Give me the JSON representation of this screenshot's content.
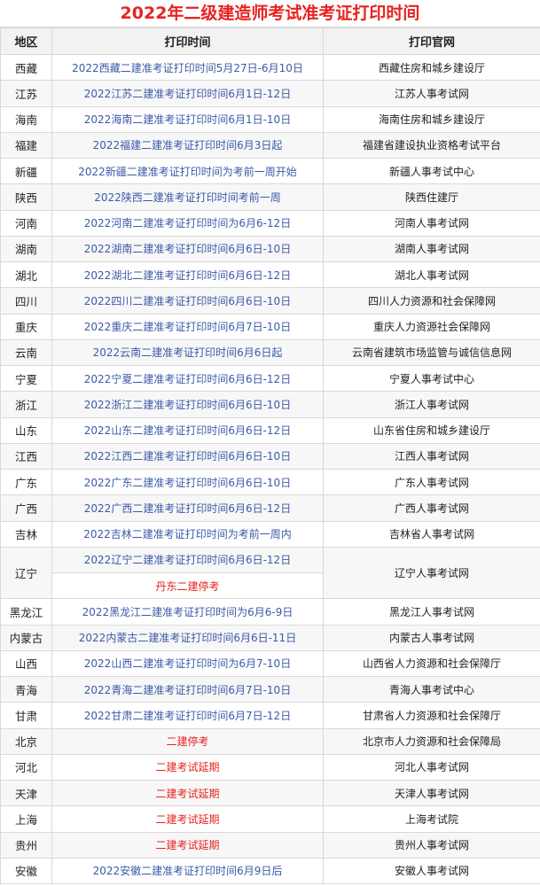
{
  "title": "2022年二级建造师考试准考证打印时间",
  "headers": [
    "地区",
    "打印时间",
    "打印官网"
  ],
  "colors": {
    "title": "#e8231f",
    "time_link": "#3b5aa8",
    "alert": "#e8231f"
  },
  "rows": [
    {
      "region": "西藏",
      "time": "2022西藏二建准考证打印时间5月27日-6月10日",
      "site": "西藏住房和城乡建设厅"
    },
    {
      "region": "江苏",
      "time": "2022江苏二建准考证打印时间6月1日-12日",
      "site": "江苏人事考试网"
    },
    {
      "region": "海南",
      "time": "2022海南二建准考证打印时间6月1日-10日",
      "site": "海南住房和城乡建设厅"
    },
    {
      "region": "福建",
      "time": "2022福建二建准考证打印时间6月3日起",
      "site": "福建省建设执业资格考试平台"
    },
    {
      "region": "新疆",
      "time": "2022新疆二建准考证打印时间为考前一周开始",
      "site": "新疆人事考试中心"
    },
    {
      "region": "陕西",
      "time": "2022陕西二建准考证打印时间考前一周",
      "site": "陕西住建厅"
    },
    {
      "region": "河南",
      "time": "2022河南二建准考证打印时间为6月6-12日",
      "site": "河南人事考试网"
    },
    {
      "region": "湖南",
      "time": "2022湖南二建准考证打印时间6月6日-10日",
      "site": "湖南人事考试网"
    },
    {
      "region": "湖北",
      "time": "2022湖北二建准考证打印时间6月6日-12日",
      "site": "湖北人事考试网"
    },
    {
      "region": "四川",
      "time": "2022四川二建准考证打印时间6月6日-10日",
      "site": "四川人力资源和社会保障网"
    },
    {
      "region": "重庆",
      "time": "2022重庆二建准考证打印时间6月7日-10日",
      "site": "重庆人力资源社会保障网"
    },
    {
      "region": "云南",
      "time": "2022云南二建准考证打印时间6月6日起",
      "site": "云南省建筑市场监管与诚信信息网"
    },
    {
      "region": "宁夏",
      "time": "2022宁夏二建准考证打印时间6月6日-12日",
      "site": "宁夏人事考试中心"
    },
    {
      "region": "浙江",
      "time": "2022浙江二建准考证打印时间6月6日-10日",
      "site": "浙江人事考试网"
    },
    {
      "region": "山东",
      "time": "2022山东二建准考证打印时间6月6日-12日",
      "site": "山东省住房和城乡建设厅"
    },
    {
      "region": "江西",
      "time": "2022江西二建准考证打印时间6月6日-10日",
      "site": "江西人事考试网"
    },
    {
      "region": "广东",
      "time": "2022广东二建准考证打印时间6月6日-10日",
      "site": "广东人事考试网"
    },
    {
      "region": "广西",
      "time": "2022广西二建准考证打印时间6月6日-12日",
      "site": "广西人事考试网"
    },
    {
      "region": "吉林",
      "time": "2022吉林二建准考证打印时间为考前一周内",
      "site": "吉林省人事考试网"
    }
  ],
  "liaoning": {
    "region": "辽宁",
    "time": "2022辽宁二建准考证打印时间6月6日-12日",
    "note": "丹东二建停考",
    "site": "辽宁人事考试网"
  },
  "rows2": [
    {
      "region": "黑龙江",
      "time": "2022黑龙江二建准考证打印时间为6月6-9日",
      "site": "黑龙江人事考试网"
    },
    {
      "region": "内蒙古",
      "time": "2022内蒙古二建准考证打印时间6月6日-11日",
      "site": "内蒙古人事考试网"
    },
    {
      "region": "山西",
      "time": "2022山西二建准考证打印时间为6月7-10日",
      "site": "山西省人力资源和社会保障厅"
    },
    {
      "region": "青海",
      "time": "2022青海二建准考证打印时间6月7日-10日",
      "site": "青海人事考试中心"
    },
    {
      "region": "甘肃",
      "time": "2022甘肃二建准考证打印时间6月7日-12日",
      "site": "甘肃省人力资源和社会保障厅"
    },
    {
      "region": "北京",
      "time": "二建停考",
      "site": "北京市人力资源和社会保障局",
      "alert": true
    },
    {
      "region": "河北",
      "time": "二建考试延期",
      "site": "河北人事考试网",
      "alert": true
    },
    {
      "region": "天津",
      "time": "二建考试延期",
      "site": "天津人事考试网",
      "alert": true
    },
    {
      "region": "上海",
      "time": "二建考试延期",
      "site": "上海考试院",
      "alert": true
    },
    {
      "region": "贵州",
      "time": "二建考试延期",
      "site": "贵州人事考试网",
      "alert": true
    },
    {
      "region": "安徽",
      "time": "2022安徽二建准考证打印时间6月9日后",
      "site": "安徽人事考试网"
    }
  ]
}
